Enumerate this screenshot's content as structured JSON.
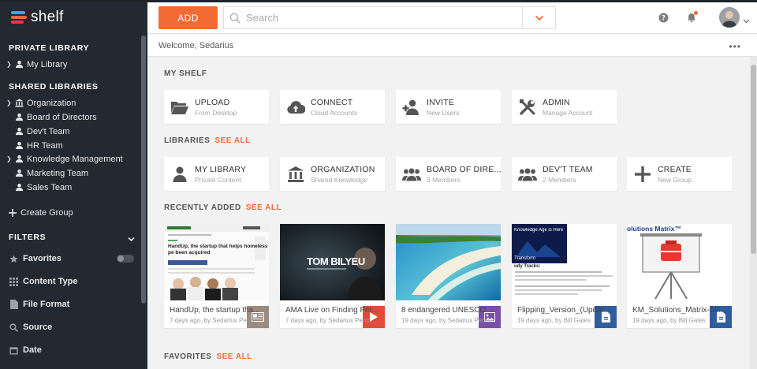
{
  "app": {
    "name": "shelf"
  },
  "colors": {
    "accent": "#f26b33",
    "sidebar": "#222930",
    "badge_blue": "#2f5d9e",
    "badge_red": "#e14b3b",
    "badge_purple": "#7a4fa8"
  },
  "sidebar": {
    "private_title": "PRIVATE LIBRARY",
    "private_items": [
      {
        "label": "My Library",
        "icon": "user-icon"
      }
    ],
    "shared_title": "SHARED LIBRARIES",
    "shared_items": [
      {
        "label": "Organization",
        "icon": "building-icon"
      },
      {
        "label": "Board of Directors",
        "icon": "group-icon"
      },
      {
        "label": "Dev't Team",
        "icon": "group-icon"
      },
      {
        "label": "HR Team",
        "icon": "group-icon"
      },
      {
        "label": "Knowledge Management",
        "icon": "group-icon"
      },
      {
        "label": "Marketing Team",
        "icon": "group-icon"
      },
      {
        "label": "Sales Team",
        "icon": "group-icon"
      }
    ],
    "create_group": "Create Group",
    "filters_title": "FILTERS",
    "filters": [
      {
        "label": "Favorites",
        "icon": "star-icon"
      },
      {
        "label": "Content Type",
        "icon": "grid-icon"
      },
      {
        "label": "File Format",
        "icon": "file-icon"
      },
      {
        "label": "Source",
        "icon": "search-icon"
      },
      {
        "label": "Date",
        "icon": "calendar-icon"
      }
    ]
  },
  "header": {
    "add_label": "ADD",
    "search_placeholder": "Search"
  },
  "welcome": {
    "text": "Welcome, Sedarius"
  },
  "my_shelf": {
    "title": "MY SHELF",
    "cards": [
      {
        "title": "UPLOAD",
        "sub": "From Desktop",
        "icon": "folder-open-icon"
      },
      {
        "title": "CONNECT",
        "sub": "Cloud Accounts",
        "icon": "cloud-upload-icon"
      },
      {
        "title": "INVITE",
        "sub": "New Users",
        "icon": "user-plus-icon"
      },
      {
        "title": "ADMIN",
        "sub": "Manage Account",
        "icon": "tools-icon"
      }
    ]
  },
  "libraries": {
    "title": "LIBRARIES",
    "see_all": "SEE ALL",
    "cards": [
      {
        "title": "MY LIBRARY",
        "sub": "Private Content",
        "icon": "user-icon"
      },
      {
        "title": "ORGANIZATION",
        "sub": "Shared Knowledge",
        "icon": "building-icon"
      },
      {
        "title": "BOARD OF DIRE...",
        "sub": "3 Members",
        "icon": "group-icon"
      },
      {
        "title": "DEV'T TEAM",
        "sub": "2 Members",
        "icon": "group-icon"
      },
      {
        "title": "CREATE",
        "sub": "New Group",
        "icon": "plus-icon"
      }
    ]
  },
  "recent": {
    "title": "RECENTLY ADDED",
    "see_all": "SEE ALL",
    "items": [
      {
        "title": "HandUp, the startup tha...",
        "meta": "7 days ago, by Sedarius Perro...",
        "badge": "article-icon",
        "thumb_headline": "HandUp, the startup that helps homeless pe been acquired"
      },
      {
        "title": "AMA Live on Finding Per...",
        "meta": "7 days ago, by Sedarius Perro...",
        "badge": "play-icon",
        "thumb_headline": "TOM BILYEU"
      },
      {
        "title": "8 endangered UNESCO s...",
        "meta": "19 days ago, by Sedarius Perro...",
        "badge": "image-icon"
      },
      {
        "title": "Flipping_Version_(Updat...",
        "meta": "19 days ago, by Bill Gates",
        "badge": "document-icon",
        "thumb_headline": "Knowledge Age is Here",
        "thumb_sub": "Transform",
        "thumb_body": "udy Tracks:"
      },
      {
        "title": "KM_Solutions_Matrix-Slid...",
        "meta": "19 days ago, by Bill Gates",
        "badge": "document-icon",
        "thumb_headline": "olutions Matrix™"
      }
    ]
  },
  "favorites": {
    "title": "FAVORITES",
    "see_all": "SEE ALL"
  }
}
